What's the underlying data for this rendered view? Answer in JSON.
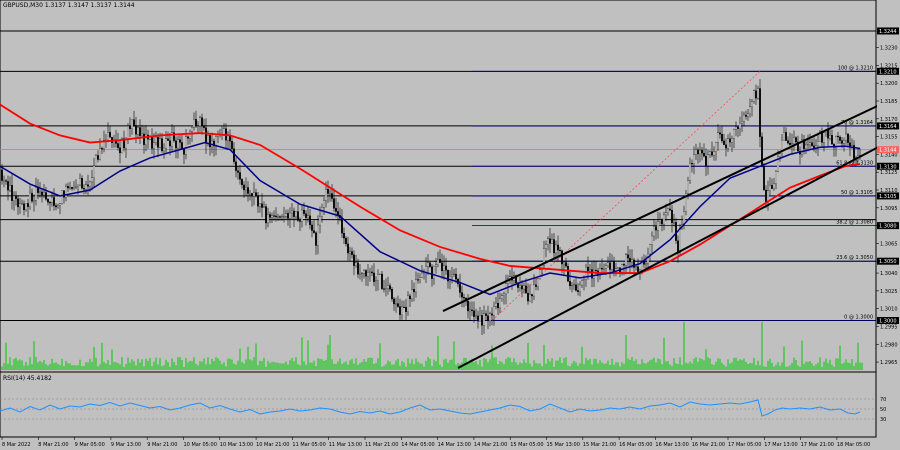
{
  "window": {
    "symbol_title": "GBPUSD,M30  1.3137 1.3147 1.3137 1.3144",
    "rsi_title": "RSI(14) 45.4182"
  },
  "colors": {
    "background": "#c0c0c0",
    "ma_fast": "#00008b",
    "ma_slow": "#ff0000",
    "candle": "#000000",
    "volume": "#00c800",
    "rsi": "#1e90ff",
    "hline": "#000000",
    "fib_line": "#000080",
    "fib_diag": "#ff4040"
  },
  "chart_data": {
    "type": "candlestick",
    "price_axis": {
      "ylim": [
        1.296,
        1.326
      ],
      "ticks": [
        "1.3230",
        "1.3215",
        "1.3200",
        "1.3185",
        "1.3170",
        "1.3155",
        "1.3140",
        "1.3125",
        "1.3110",
        "1.3095",
        "1.3080",
        "1.3065",
        "1.3050",
        "1.3040",
        "1.3025",
        "1.3010",
        "1.2995",
        "1.2980",
        "1.2965"
      ]
    },
    "price_labels": [
      {
        "text": "1.3244",
        "y": 1.3244
      },
      {
        "text": "1.3210",
        "y": 1.321
      },
      {
        "text": "1.3164",
        "y": 1.3164
      },
      {
        "text": "1.3144",
        "y": 1.3144
      },
      {
        "text": "1.3130",
        "y": 1.313
      },
      {
        "text": "1.3105",
        "y": 1.3105
      },
      {
        "text": "1.3080",
        "y": 1.308
      },
      {
        "text": "1.3050",
        "y": 1.305
      },
      {
        "text": "1.3000",
        "y": 1.3
      }
    ],
    "horizontal_levels": [
      1.3244,
      1.321,
      1.3164,
      1.313,
      1.3105,
      1.3085,
      1.305,
      1.3
    ],
    "fibonacci": [
      {
        "label": "100 @ 1.3210",
        "value": 1.321
      },
      {
        "label": "76 @ 1.3164",
        "value": 1.3164
      },
      {
        "label": "61.8 @ 1.3130",
        "value": 1.313
      },
      {
        "label": "50 @ 1.3105",
        "value": 1.3105
      },
      {
        "label": "38.2 @ 1.3080",
        "value": 1.308
      },
      {
        "label": "23.6 @ 1.3050",
        "value": 1.305
      },
      {
        "label": "0 @ 1.3000",
        "value": 1.3
      }
    ],
    "x_labels": [
      "8 Mar 2022",
      "8 Mar 21:00",
      "9 Mar 05:00",
      "9 Mar 13:00",
      "9 Mar 21:00",
      "10 Mar 05:00",
      "10 Mar 13:00",
      "10 Mar 21:00",
      "11 Mar 05:00",
      "11 Mar 13:00",
      "11 Mar 21:00",
      "14 Mar 05:00",
      "14 Mar 13:00",
      "14 Mar 21:00",
      "15 Mar 05:00",
      "15 Mar 13:00",
      "15 Mar 21:00",
      "16 Mar 05:00",
      "16 Mar 13:00",
      "16 Mar 21:00",
      "17 Mar 05:00",
      "17 Mar 13:00",
      "17 Mar 21:00",
      "18 Mar 05:00"
    ],
    "price_path": [
      [
        0,
        1.3127
      ],
      [
        8,
        1.3112
      ],
      [
        18,
        1.3094
      ],
      [
        28,
        1.31
      ],
      [
        38,
        1.3108
      ],
      [
        48,
        1.3104
      ],
      [
        56,
        1.3096
      ],
      [
        66,
        1.3112
      ],
      [
        78,
        1.3118
      ],
      [
        90,
        1.3113
      ],
      [
        100,
        1.3148
      ],
      [
        110,
        1.3158
      ],
      [
        120,
        1.3144
      ],
      [
        132,
        1.3166
      ],
      [
        142,
        1.3154
      ],
      [
        152,
        1.315
      ],
      [
        162,
        1.3148
      ],
      [
        172,
        1.3154
      ],
      [
        182,
        1.3142
      ],
      [
        192,
        1.3162
      ],
      [
        200,
        1.317
      ],
      [
        206,
        1.3152
      ],
      [
        214,
        1.3146
      ],
      [
        224,
        1.3162
      ],
      [
        232,
        1.3142
      ],
      [
        240,
        1.3117
      ],
      [
        250,
        1.3104
      ],
      [
        258,
        1.31
      ],
      [
        266,
        1.3088
      ],
      [
        276,
        1.3088
      ],
      [
        286,
        1.309
      ],
      [
        296,
        1.3086
      ],
      [
        306,
        1.309
      ],
      [
        316,
        1.3068
      ],
      [
        326,
        1.3108
      ],
      [
        336,
        1.3094
      ],
      [
        346,
        1.3064
      ],
      [
        356,
        1.3044
      ],
      [
        368,
        1.3036
      ],
      [
        380,
        1.3034
      ],
      [
        390,
        1.3026
      ],
      [
        398,
        1.3008
      ],
      [
        406,
        1.3013
      ],
      [
        416,
        1.303
      ],
      [
        424,
        1.3046
      ],
      [
        432,
        1.304
      ],
      [
        440,
        1.3052
      ],
      [
        448,
        1.3034
      ],
      [
        456,
        1.3038
      ],
      [
        464,
        1.3014
      ],
      [
        472,
        1.3004
      ],
      [
        480,
        1.3002
      ],
      [
        488,
        1.3
      ],
      [
        496,
        1.3009
      ],
      [
        504,
        1.3025
      ],
      [
        512,
        1.3034
      ],
      [
        520,
        1.303
      ],
      [
        528,
        1.3022
      ],
      [
        536,
        1.303
      ],
      [
        546,
        1.3066
      ],
      [
        556,
        1.3062
      ],
      [
        566,
        1.304
      ],
      [
        576,
        1.3026
      ],
      [
        586,
        1.304
      ],
      [
        596,
        1.3038
      ],
      [
        606,
        1.3048
      ],
      [
        616,
        1.3044
      ],
      [
        626,
        1.305
      ],
      [
        636,
        1.3042
      ],
      [
        646,
        1.305
      ],
      [
        654,
        1.3074
      ],
      [
        662,
        1.3084
      ],
      [
        670,
        1.3096
      ],
      [
        678,
        1.306
      ],
      [
        684,
        1.3096
      ],
      [
        690,
        1.3132
      ],
      [
        698,
        1.314
      ],
      [
        708,
        1.3134
      ],
      [
        718,
        1.3154
      ],
      [
        728,
        1.315
      ],
      [
        738,
        1.316
      ],
      [
        746,
        1.3172
      ],
      [
        752,
        1.3186
      ],
      [
        758,
        1.3194
      ],
      [
        762,
        1.3124
      ],
      [
        766,
        1.3106
      ],
      [
        772,
        1.3112
      ],
      [
        778,
        1.3138
      ],
      [
        784,
        1.316
      ],
      [
        792,
        1.315
      ],
      [
        800,
        1.3146
      ],
      [
        808,
        1.3148
      ],
      [
        816,
        1.315
      ],
      [
        824,
        1.3158
      ],
      [
        832,
        1.3152
      ],
      [
        840,
        1.315
      ],
      [
        846,
        1.3154
      ],
      [
        852,
        1.3144
      ],
      [
        856,
        1.3138
      ],
      [
        860,
        1.314
      ]
    ],
    "ma_fast_path": [
      [
        0,
        1.313
      ],
      [
        30,
        1.3115
      ],
      [
        60,
        1.3105
      ],
      [
        90,
        1.311
      ],
      [
        120,
        1.3126
      ],
      [
        150,
        1.3137
      ],
      [
        180,
        1.3144
      ],
      [
        205,
        1.315
      ],
      [
        230,
        1.3144
      ],
      [
        260,
        1.3118
      ],
      [
        300,
        1.3098
      ],
      [
        340,
        1.3088
      ],
      [
        380,
        1.3058
      ],
      [
        420,
        1.3042
      ],
      [
        460,
        1.3032
      ],
      [
        490,
        1.3022
      ],
      [
        520,
        1.3032
      ],
      [
        550,
        1.304
      ],
      [
        580,
        1.3036
      ],
      [
        610,
        1.304
      ],
      [
        640,
        1.3048
      ],
      [
        670,
        1.3068
      ],
      [
        700,
        1.3096
      ],
      [
        730,
        1.312
      ],
      [
        760,
        1.313
      ],
      [
        790,
        1.314
      ],
      [
        820,
        1.3146
      ],
      [
        845,
        1.3147
      ],
      [
        860,
        1.3145
      ]
    ],
    "ma_slow_path": [
      [
        0,
        1.3182
      ],
      [
        30,
        1.3166
      ],
      [
        60,
        1.3156
      ],
      [
        90,
        1.315
      ],
      [
        120,
        1.3152
      ],
      [
        160,
        1.3156
      ],
      [
        200,
        1.3158
      ],
      [
        230,
        1.3156
      ],
      [
        260,
        1.3148
      ],
      [
        300,
        1.3128
      ],
      [
        330,
        1.3112
      ],
      [
        360,
        1.3096
      ],
      [
        400,
        1.3076
      ],
      [
        440,
        1.3062
      ],
      [
        480,
        1.3052
      ],
      [
        510,
        1.3046
      ],
      [
        540,
        1.3044
      ],
      [
        570,
        1.3042
      ],
      [
        600,
        1.304
      ],
      [
        640,
        1.304
      ],
      [
        670,
        1.305
      ],
      [
        700,
        1.3064
      ],
      [
        730,
        1.308
      ],
      [
        760,
        1.3096
      ],
      [
        790,
        1.3112
      ],
      [
        820,
        1.3122
      ],
      [
        845,
        1.313
      ],
      [
        860,
        1.3132
      ]
    ],
    "trendlines": [
      {
        "x1": 443,
        "y1": 1.3008,
        "x2": 888,
        "y2": 1.3185
      },
      {
        "x1": 458,
        "y1": 1.296,
        "x2": 878,
        "y2": 1.3146
      }
    ],
    "fib_diagonal": {
      "x1": 492,
      "y1": 1.3,
      "x2": 760,
      "y2": 1.321
    },
    "volume_ylim": [
      0,
      1
    ],
    "rsi": {
      "ylim": [
        0,
        100
      ],
      "levels": [
        70,
        50,
        30
      ],
      "tick_labels": [
        "70",
        "50",
        "30"
      ],
      "path": [
        [
          0,
          46
        ],
        [
          10,
          52
        ],
        [
          20,
          44
        ],
        [
          30,
          55
        ],
        [
          40,
          48
        ],
        [
          50,
          58
        ],
        [
          60,
          50
        ],
        [
          70,
          56
        ],
        [
          80,
          54
        ],
        [
          90,
          60
        ],
        [
          100,
          57
        ],
        [
          110,
          63
        ],
        [
          120,
          56
        ],
        [
          130,
          62
        ],
        [
          140,
          57
        ],
        [
          150,
          52
        ],
        [
          160,
          55
        ],
        [
          170,
          48
        ],
        [
          180,
          52
        ],
        [
          190,
          58
        ],
        [
          200,
          62
        ],
        [
          210,
          52
        ],
        [
          220,
          57
        ],
        [
          230,
          50
        ],
        [
          240,
          44
        ],
        [
          250,
          49
        ],
        [
          260,
          40
        ],
        [
          270,
          44
        ],
        [
          280,
          46
        ],
        [
          290,
          50
        ],
        [
          300,
          46
        ],
        [
          310,
          48
        ],
        [
          320,
          52
        ],
        [
          330,
          50
        ],
        [
          340,
          44
        ],
        [
          350,
          40
        ],
        [
          360,
          45
        ],
        [
          370,
          42
        ],
        [
          380,
          46
        ],
        [
          390,
          40
        ],
        [
          400,
          44
        ],
        [
          410,
          52
        ],
        [
          420,
          58
        ],
        [
          430,
          48
        ],
        [
          440,
          50
        ],
        [
          450,
          46
        ],
        [
          460,
          42
        ],
        [
          470,
          40
        ],
        [
          480,
          44
        ],
        [
          490,
          48
        ],
        [
          500,
          52
        ],
        [
          510,
          58
        ],
        [
          520,
          55
        ],
        [
          530,
          46
        ],
        [
          540,
          50
        ],
        [
          550,
          60
        ],
        [
          560,
          52
        ],
        [
          570,
          44
        ],
        [
          580,
          50
        ],
        [
          590,
          46
        ],
        [
          600,
          48
        ],
        [
          610,
          52
        ],
        [
          620,
          50
        ],
        [
          630,
          54
        ],
        [
          640,
          50
        ],
        [
          650,
          56
        ],
        [
          660,
          58
        ],
        [
          670,
          62
        ],
        [
          680,
          54
        ],
        [
          690,
          64
        ],
        [
          700,
          60
        ],
        [
          710,
          58
        ],
        [
          720,
          60
        ],
        [
          730,
          62
        ],
        [
          740,
          60
        ],
        [
          750,
          64
        ],
        [
          758,
          68
        ],
        [
          762,
          36
        ],
        [
          768,
          40
        ],
        [
          775,
          48
        ],
        [
          782,
          52
        ],
        [
          790,
          50
        ],
        [
          800,
          52
        ],
        [
          810,
          50
        ],
        [
          820,
          54
        ],
        [
          830,
          48
        ],
        [
          840,
          50
        ],
        [
          848,
          42
        ],
        [
          855,
          40
        ],
        [
          860,
          44
        ]
      ]
    }
  }
}
